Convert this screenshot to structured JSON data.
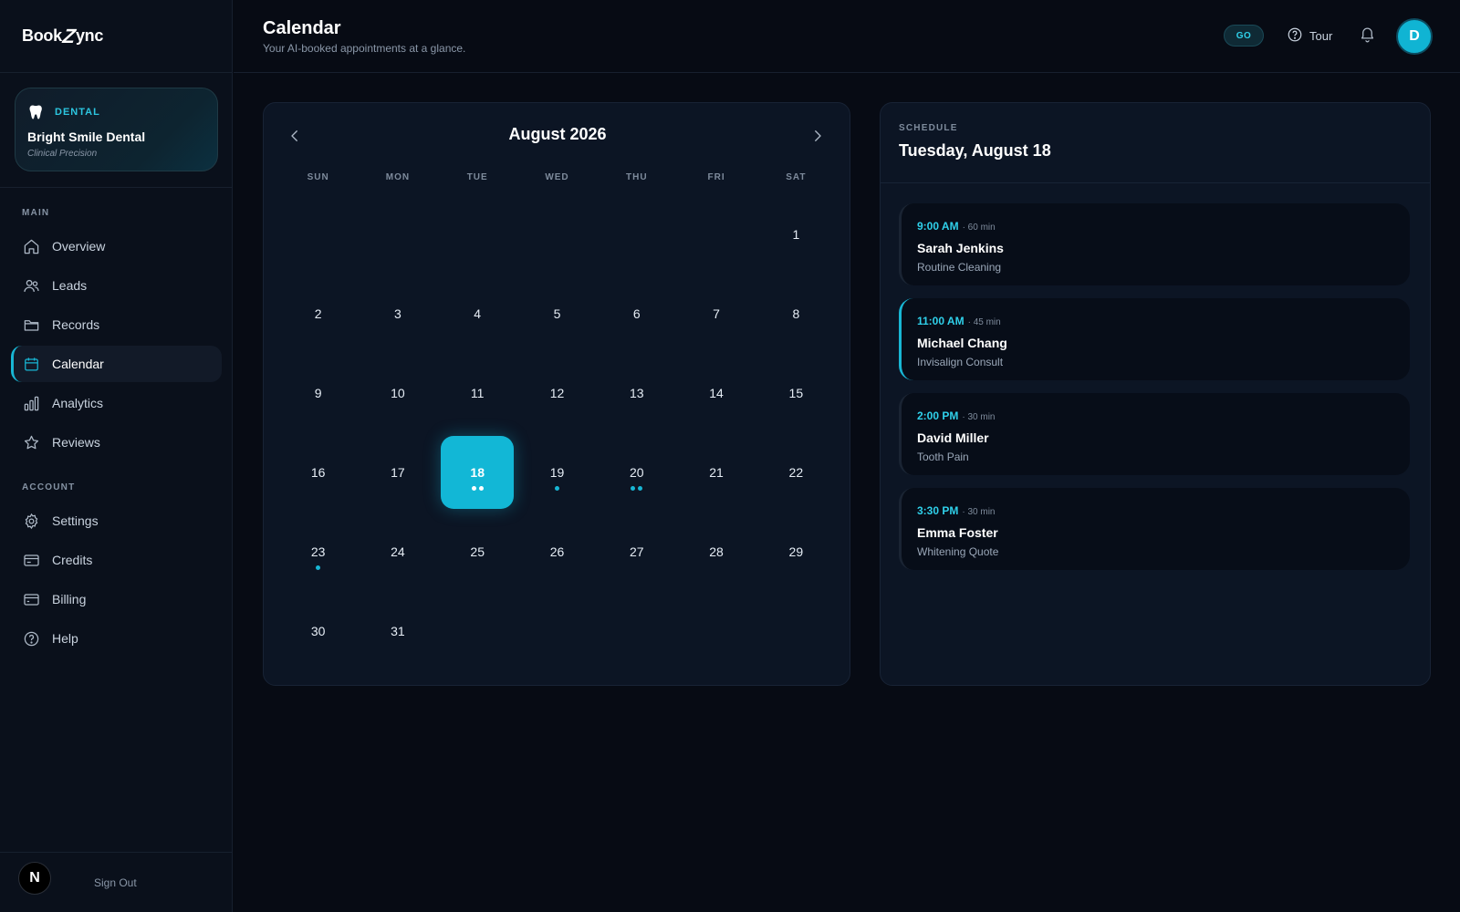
{
  "brand": {
    "name_pre": "Book",
    "name_z": "Z",
    "name_post": "ync"
  },
  "clinic": {
    "tag": "DENTAL",
    "name": "Bright Smile Dental",
    "tagline": "Clinical Precision"
  },
  "sidebar": {
    "main_label": "MAIN",
    "main_items": [
      {
        "label": "Overview",
        "icon": "home-icon"
      },
      {
        "label": "Leads",
        "icon": "users-icon"
      },
      {
        "label": "Records",
        "icon": "folder-icon"
      },
      {
        "label": "Calendar",
        "icon": "calendar-icon",
        "active": true
      },
      {
        "label": "Analytics",
        "icon": "bar-chart-icon"
      },
      {
        "label": "Reviews",
        "icon": "star-icon"
      }
    ],
    "account_label": "ACCOUNT",
    "account_items": [
      {
        "label": "Settings",
        "icon": "gear-icon"
      },
      {
        "label": "Credits",
        "icon": "credit-card-icon"
      },
      {
        "label": "Billing",
        "icon": "billing-card-icon"
      },
      {
        "label": "Help",
        "icon": "help-circle-icon"
      }
    ],
    "footer": {
      "badge": "N",
      "sign_out": "Sign Out"
    }
  },
  "header": {
    "title": "Calendar",
    "subtitle": "Your AI-booked appointments at a glance.",
    "go_label": "GO",
    "tour_label": "Tour",
    "avatar_initial": "D"
  },
  "calendar": {
    "month_title": "August 2026",
    "weekdays": [
      "SUN",
      "MON",
      "TUE",
      "WED",
      "THU",
      "FRI",
      "SAT"
    ],
    "leading_blanks": 6,
    "days_in_month": 31,
    "selected_day": 18,
    "appointment_dots": {
      "18": 2,
      "19": 1,
      "20": 2,
      "23": 1
    }
  },
  "schedule": {
    "label": "SCHEDULE",
    "date": "Tuesday, August 18",
    "appointments": [
      {
        "time": "9:00 AM",
        "duration": "· 60 min",
        "name": "Sarah Jenkins",
        "type": "Routine Cleaning",
        "active": false
      },
      {
        "time": "11:00 AM",
        "duration": "· 45 min",
        "name": "Michael Chang",
        "type": "Invisalign Consult",
        "active": true
      },
      {
        "time": "2:00 PM",
        "duration": "· 30 min",
        "name": "David Miller",
        "type": "Tooth Pain",
        "active": false
      },
      {
        "time": "3:30 PM",
        "duration": "· 30 min",
        "name": "Emma Foster",
        "type": "Whitening Quote",
        "active": false
      }
    ]
  },
  "colors": {
    "accent": "#12b7d6",
    "background": "#070b14",
    "card": "#0c1524"
  }
}
